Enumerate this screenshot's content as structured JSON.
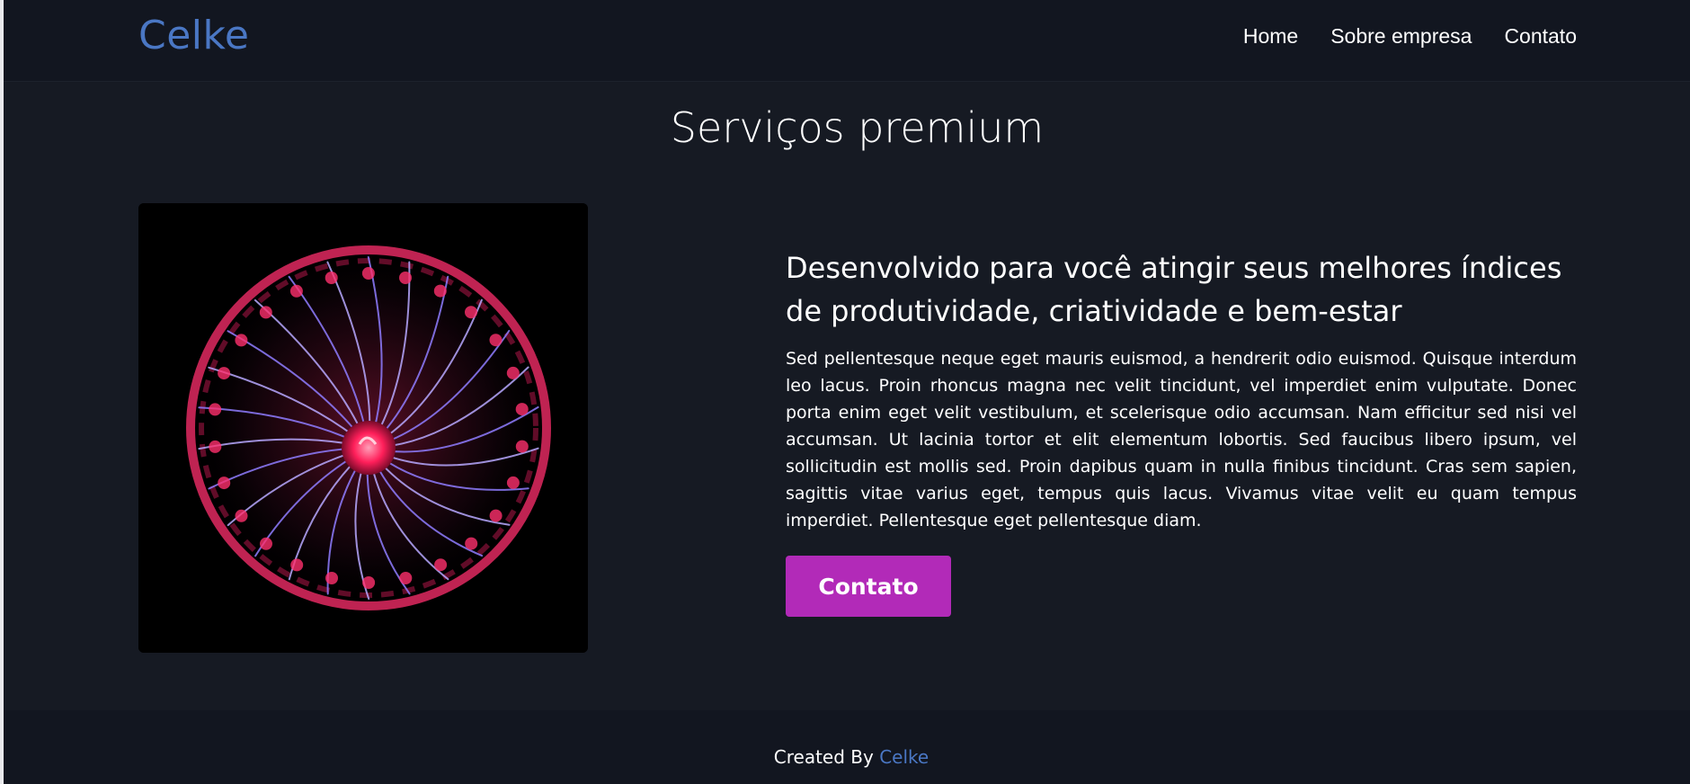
{
  "header": {
    "logo": "Celke",
    "nav": [
      {
        "label": "Home"
      },
      {
        "label": "Sobre empresa"
      },
      {
        "label": "Contato"
      }
    ]
  },
  "main": {
    "title": "Serviços premium",
    "heading": "Desenvolvido para você atingir seus melhores índices de produtividade, criatividade e bem-estar",
    "body": "Sed pellentesque neque eget mauris euismod, a hendrerit odio euismod. Quisque interdum leo lacus. Proin rhoncus magna nec velit tincidunt, vel imperdiet enim vulputate. Donec porta enim eget velit vestibulum, et scelerisque odio accumsan. Nam efficitur sed nisi vel accumsan. Ut lacinia tortor et elit elementum lobortis. Sed faucibus libero ipsum, vel sollicitudin est mollis sed. Proin dapibus quam in nulla finibus tincidunt. Cras sem sapien, sagittis vitae varius eget, tempus quis lacus. Vivamus vitae velit eu quam tempus imperdiet. Pellentesque eget pellentesque diam.",
    "cta_label": "Contato",
    "image_icon": "plasma-ball-image"
  },
  "footer": {
    "prefix": "Created By",
    "link": "Celke"
  },
  "colors": {
    "background": "#161a23",
    "header_bg": "#121620",
    "brand": "#4a77c4",
    "cta": "#b22ab8"
  }
}
